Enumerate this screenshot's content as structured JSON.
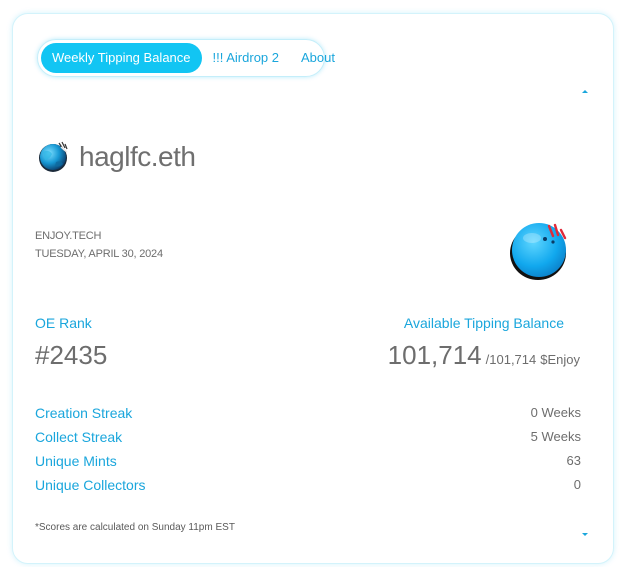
{
  "tabs": [
    {
      "label": "Weekly Tipping Balance",
      "active": true
    },
    {
      "label": "!!! Airdrop 2",
      "active": false
    },
    {
      "label": "About",
      "active": false
    }
  ],
  "profile": {
    "username": "haglfc.eth",
    "avatar_icon": "globe-avatar-icon"
  },
  "brand": "ENJOY.TECH",
  "date": "TUESDAY, APRIL 30, 2024",
  "logo_icon": "enjoy-ball-logo-icon",
  "rank": {
    "label": "OE Rank",
    "value": "#2435"
  },
  "balance": {
    "label": "Available Tipping Balance",
    "value": "101,714",
    "total": "/101,714",
    "unit": "$Enjoy"
  },
  "stats": [
    {
      "label": "Creation Streak",
      "value": "0 Weeks"
    },
    {
      "label": "Collect Streak",
      "value": "5 Weeks"
    },
    {
      "label": "Unique Mints",
      "value": "63"
    },
    {
      "label": "Unique Collectors",
      "value": "0"
    }
  ],
  "footnote": "*Scores are calculated on Sunday 11pm EST",
  "colors": {
    "accent": "#12c5f3",
    "accent_text": "#1aa6dc",
    "text": "#6d6d6d"
  }
}
